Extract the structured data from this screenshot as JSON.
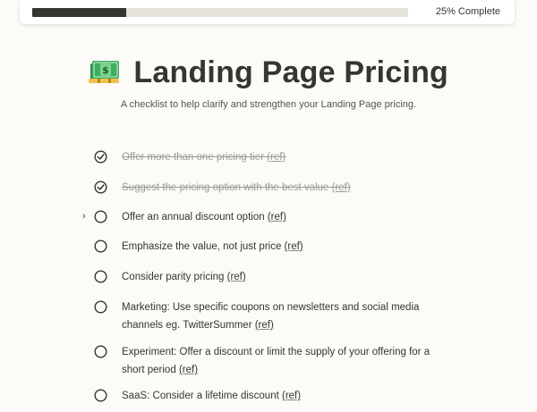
{
  "progress": {
    "fraction": 0.25,
    "label": "25% Complete",
    "fill_color": "#373530",
    "track_color": "#e6e3dc"
  },
  "page": {
    "emoji": "money-with-dollar-icon",
    "title": "Landing Page Pricing",
    "subtitle": "A checklist to help clarify and strengthen your Landing Page pricing."
  },
  "checklist": [
    {
      "text": "Offer more than one pricing tier ",
      "ref": "(ref)",
      "checked": true
    },
    {
      "text": "Suggest the pricing option with the best value ",
      "ref": "(ref)",
      "checked": true
    },
    {
      "text": "Offer an annual discount option ",
      "ref": "(ref)",
      "checked": false,
      "has_caret": true,
      "caret": "›"
    },
    {
      "text": "Emphasize the value, not just price ",
      "ref": "(ref)",
      "checked": false
    },
    {
      "text": "Consider parity pricing ",
      "ref": "(ref)",
      "checked": false
    },
    {
      "text": "Marketing: Use specific coupons on newsletters and social media channels eg. TwitterSummer ",
      "ref": "(ref)",
      "checked": false
    },
    {
      "text": "Experiment: Offer a discount or limit the supply of your offering for a short period ",
      "ref": "(ref)",
      "checked": false
    },
    {
      "text": "SaaS: Consider a lifetime discount ",
      "ref": "(ref)",
      "checked": false
    }
  ]
}
